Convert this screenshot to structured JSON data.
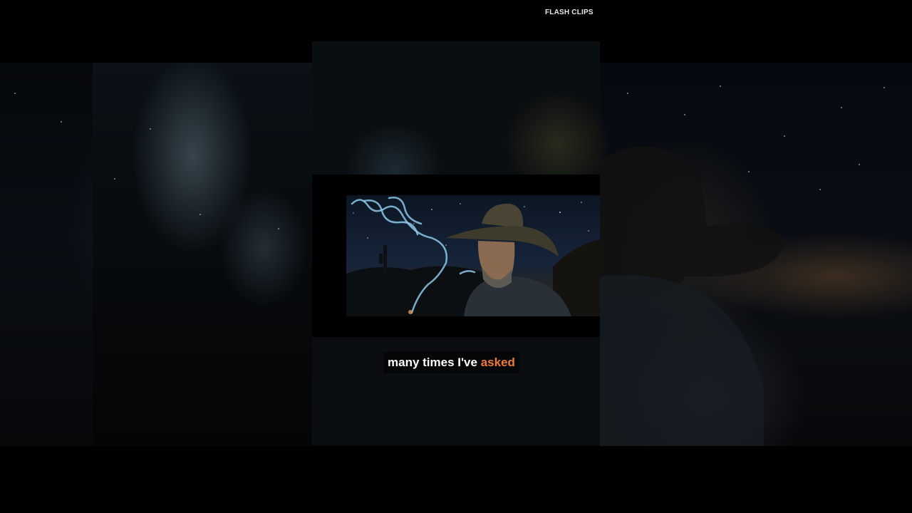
{
  "channel": {
    "watermark": "FLASH CLIPS"
  },
  "caption": {
    "text": "many times I've",
    "highlight": "asked",
    "highlight_color": "#f07a3a",
    "text_color": "#ffffff"
  },
  "scene": {
    "subject": "cowboy-with-smoke-under-night-sky"
  }
}
